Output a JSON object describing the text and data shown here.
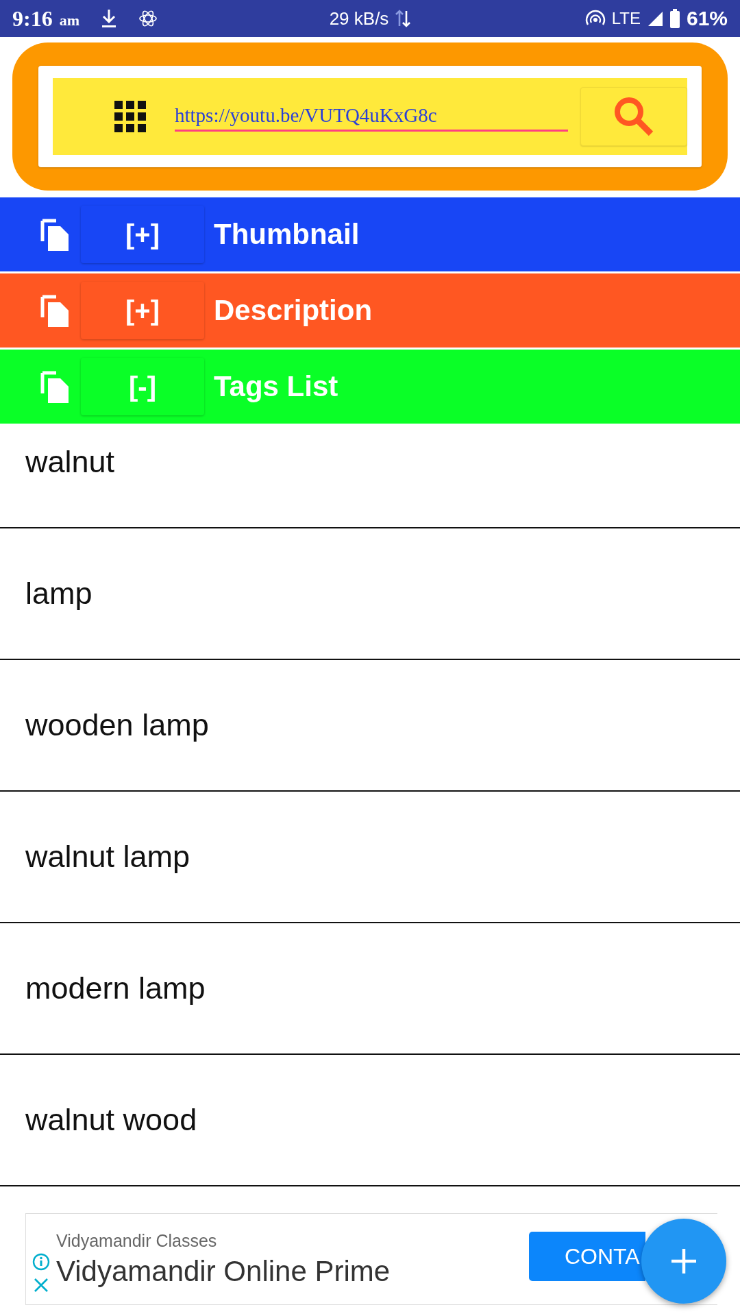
{
  "status_bar": {
    "time": "9:16",
    "ampm": "am",
    "speed": "29 kB/s",
    "network": "LTE",
    "battery": "61%"
  },
  "search": {
    "value": "https://youtu.be/VUTQ4uKxG8c"
  },
  "sections": [
    {
      "title": "Thumbnail",
      "toggle": "[+]",
      "color": "#1846f5"
    },
    {
      "title": "Description",
      "toggle": "[+]",
      "color": "#ff5722"
    },
    {
      "title": "Tags List",
      "toggle": "[-]",
      "color": "#0aff27",
      "items": [
        "walnut",
        "lamp",
        "wooden lamp",
        "walnut lamp",
        "modern lamp",
        "walnut wood"
      ]
    }
  ],
  "ad": {
    "advertiser": "Vidyamandir Classes",
    "headline": "Vidyamandir Online Prime",
    "button": "CONTA"
  }
}
